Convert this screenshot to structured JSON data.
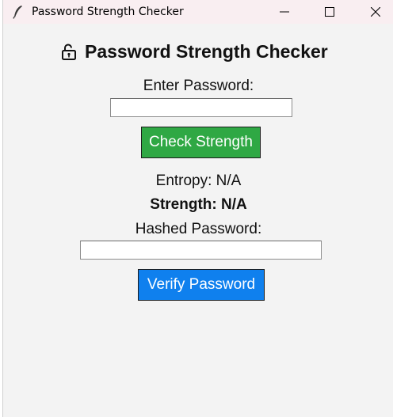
{
  "window": {
    "title": "Password Strength Checker",
    "icons": {
      "app": "feather-icon",
      "minimize": "minimize-icon",
      "maximize": "maximize-icon",
      "close": "close-icon"
    }
  },
  "content": {
    "heading_icon": "unlocked-padlock-icon",
    "heading": "Password Strength Checker",
    "password_label": "Enter Password:",
    "password_value": "",
    "check_button": "Check Strength",
    "entropy_text": "Entropy: N/A",
    "strength_text": "Strength: N/A",
    "hashed_label": "Hashed Password:",
    "hashed_value": "",
    "verify_button": "Verify Password"
  },
  "colors": {
    "check_button_bg": "#2fa844",
    "verify_button_bg": "#0f80ee",
    "window_bg": "#f3f3f3",
    "titlebar_bg": "#f9eef1"
  }
}
